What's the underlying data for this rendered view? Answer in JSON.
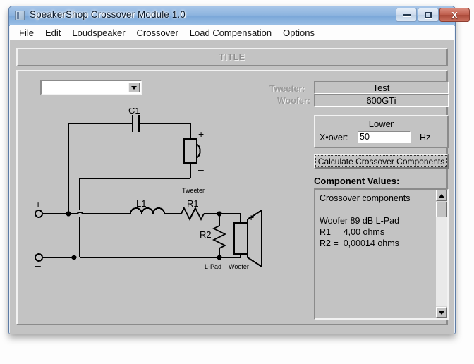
{
  "window": {
    "title": "SpeakerShop Crossover Module 1.0",
    "icon": "app-icon",
    "buttons": {
      "minimize": "–",
      "maximize": "□",
      "close": "X"
    }
  },
  "menu": {
    "items": [
      {
        "label": "File"
      },
      {
        "label": "Edit"
      },
      {
        "label": "Loudspeaker"
      },
      {
        "label": "Crossover"
      },
      {
        "label": "Load Compensation"
      },
      {
        "label": "Options"
      }
    ]
  },
  "title_panel": {
    "label": "TITLE"
  },
  "combo": {
    "value": "",
    "arrow_icon": "chevron-down-icon"
  },
  "drivers": {
    "tweeter_label": "Tweeter:",
    "tweeter_value": "Test",
    "woofer_label": "Woofer:",
    "woofer_value": "600GTi"
  },
  "lower_group": {
    "title": "Lower",
    "xover_label": "X•over:",
    "xover_value": "50",
    "unit": "Hz"
  },
  "calculate_button": {
    "label": "Calculate Crossover Components"
  },
  "component_values": {
    "heading": "Component Values:",
    "text": "Crossover components\n\nWoofer 89 dB L-Pad\nR1 =  4,00 ohms\nR2 =  0,00014 ohms",
    "scroll_up_icon": "triangle-up-icon",
    "scroll_down_icon": "triangle-down-icon"
  },
  "circuit": {
    "labels": {
      "c1": "C1",
      "l1": "L1",
      "r1": "R1",
      "r2": "R2",
      "tweeter": "Tweeter",
      "woofer": "Woofer",
      "lpad": "L-Pad",
      "in_plus": "+",
      "in_minus": "–",
      "tweeter_plus": "+",
      "tweeter_minus": "–",
      "woofer_plus": "+",
      "woofer_minus": "–"
    }
  },
  "colors": {
    "face": "#c3c3c3",
    "titlebar": "#8db4df",
    "close_button": "#c0604f",
    "wire": "#000000",
    "field_bg": "#ffffff"
  }
}
